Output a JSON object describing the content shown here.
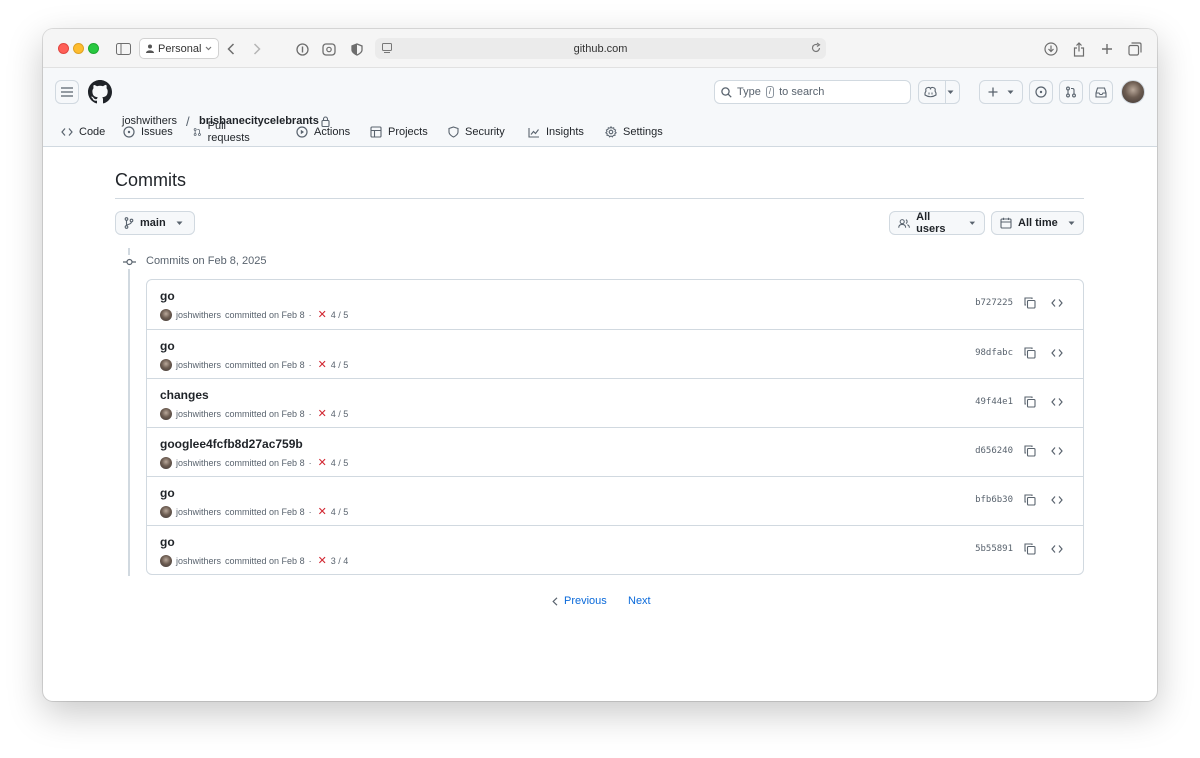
{
  "browser": {
    "profile": "Personal",
    "url": "github.com"
  },
  "header": {
    "owner": "joshwithers",
    "separator": "/",
    "repo": "brisbanecitycelebrants",
    "search_prefix": "Type",
    "search_key": "/",
    "search_suffix": "to search"
  },
  "tabs": [
    {
      "label": "Code",
      "icon": "code-icon"
    },
    {
      "label": "Issues",
      "icon": "issue-icon"
    },
    {
      "label": "Pull requests",
      "icon": "pull-request-icon"
    },
    {
      "label": "Actions",
      "icon": "play-icon"
    },
    {
      "label": "Projects",
      "icon": "table-icon"
    },
    {
      "label": "Security",
      "icon": "shield-icon"
    },
    {
      "label": "Insights",
      "icon": "graph-icon"
    },
    {
      "label": "Settings",
      "icon": "gear-icon"
    }
  ],
  "page": {
    "title": "Commits",
    "branch": "main",
    "users_filter": "All users",
    "time_filter": "All time",
    "day_heading": "Commits on Feb 8, 2025"
  },
  "commits": [
    {
      "message": "go",
      "author": "joshwithers",
      "action": "committed on Feb 8",
      "checks": "4 / 5",
      "sha": "b727225"
    },
    {
      "message": "go",
      "author": "joshwithers",
      "action": "committed on Feb 8",
      "checks": "4 / 5",
      "sha": "98dfabc"
    },
    {
      "message": "changes",
      "author": "joshwithers",
      "action": "committed on Feb 8",
      "checks": "4 / 5",
      "sha": "49f44e1"
    },
    {
      "message": "googlee4fcfb8d27ac759b",
      "author": "joshwithers",
      "action": "committed on Feb 8",
      "checks": "4 / 5",
      "sha": "d656240"
    },
    {
      "message": "go",
      "author": "joshwithers",
      "action": "committed on Feb 8",
      "checks": "4 / 5",
      "sha": "bfb6b30"
    },
    {
      "message": "go",
      "author": "joshwithers",
      "action": "committed on Feb 8",
      "checks": "3 / 4",
      "sha": "5b55891"
    }
  ],
  "pagination": {
    "previous": "Previous",
    "next": "Next"
  },
  "colors": {
    "link": "#0969da",
    "failure": "#d1242f",
    "border": "#d1d9e0"
  }
}
